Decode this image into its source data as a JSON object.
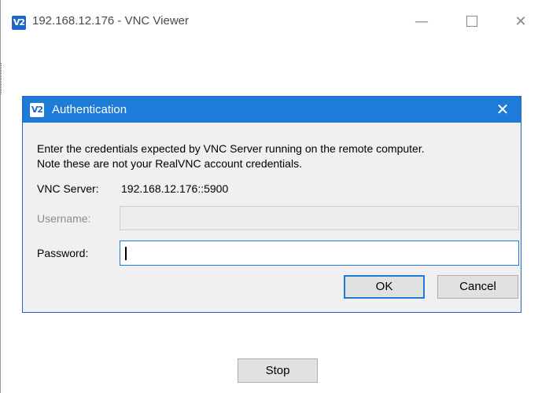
{
  "main_window": {
    "logo_text": "V2",
    "title": "192.168.12.176 - VNC Viewer",
    "minimize_glyph": "—",
    "close_glyph": "✕",
    "stop_button": "Stop"
  },
  "dialog": {
    "logo_text": "V2",
    "title": "Authentication",
    "close_glyph": "✕",
    "message_line1": "Enter the credentials expected by VNC Server running on the remote computer.",
    "message_line2": "Note these are not your RealVNC account credentials.",
    "server_label": "VNC Server:",
    "server_value": "192.168.12.176::5900",
    "username_label": "Username:",
    "username_value": "",
    "password_label": "Password:",
    "password_value": "",
    "ok_button": "OK",
    "cancel_button": "Cancel"
  },
  "colors": {
    "accent": "#1e7bd7",
    "dialog_bg": "#f0f0f0",
    "disabled_text": "#8c8c8c"
  },
  "icons": {
    "app": "vnc-viewer-logo-icon",
    "minimize": "minimize-icon",
    "maximize": "maximize-icon",
    "close": "close-icon"
  }
}
